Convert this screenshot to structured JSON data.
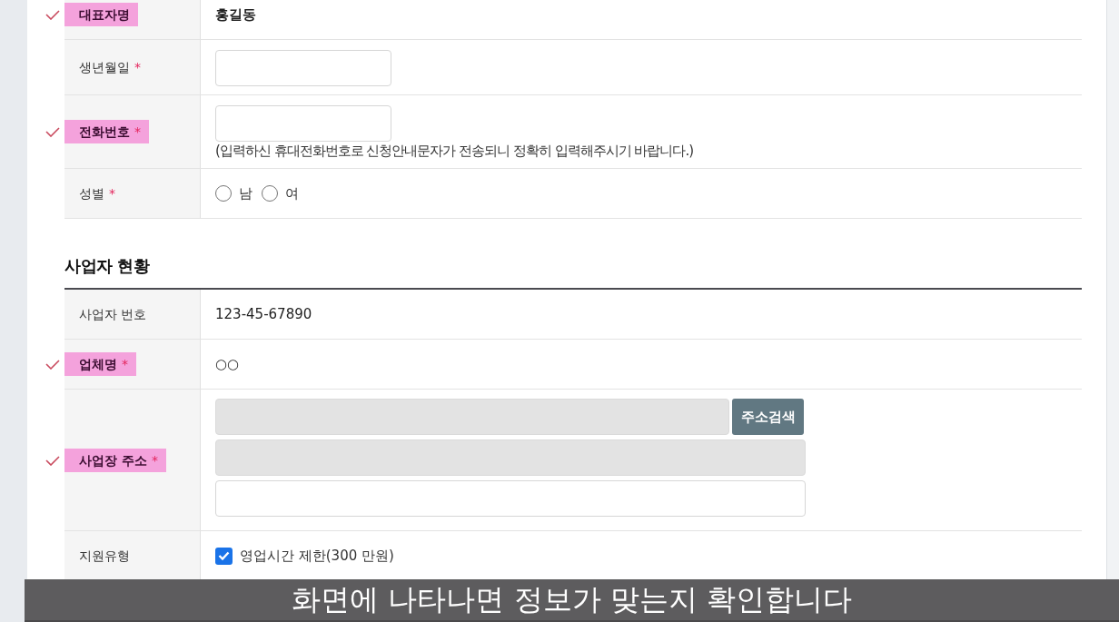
{
  "sections": [
    {
      "rows": [
        {
          "kind": "text",
          "label": "대표자명",
          "highlighted": true,
          "ticked": true,
          "value": "홍길동",
          "bold": true
        },
        {
          "kind": "input",
          "label": "생년월일",
          "required_mark": "*",
          "highlighted": false,
          "ticked": false,
          "fields": [
            {
              "disabled": false
            }
          ]
        },
        {
          "kind": "input",
          "label": "전화번호",
          "required_mark": "*",
          "highlighted": true,
          "ticked": true,
          "fields": [
            {
              "disabled": false
            }
          ],
          "note": "(입력하신 휴대전화번호로 신청안내문자가 전송되니 정확히 입력해주시기 바랍니다.)"
        },
        {
          "kind": "radio",
          "label": "성별",
          "required_mark": "*",
          "highlighted": false,
          "ticked": false,
          "options": [
            {
              "label": "남",
              "selected": false
            },
            {
              "label": "여",
              "selected": false
            }
          ]
        }
      ]
    },
    {
      "title": "사업자 현황",
      "rows": [
        {
          "kind": "text",
          "label": "사업자 번호",
          "highlighted": false,
          "ticked": false,
          "value": "123-45-67890",
          "bold": false
        },
        {
          "kind": "text",
          "label": "업체명",
          "required_mark": "*",
          "highlighted": true,
          "ticked": true,
          "value": "○○",
          "bold": false
        },
        {
          "kind": "address",
          "label": "사업장 주소",
          "required_mark": "*",
          "highlighted": true,
          "ticked": true,
          "fields": [
            {
              "disabled": true
            },
            {
              "disabled": true
            },
            {
              "disabled": false
            }
          ],
          "button": "주소검색"
        },
        {
          "kind": "checkbox",
          "label": "지원유형",
          "highlighted": false,
          "ticked": false,
          "options": [
            {
              "label": "영업시간 제한(300 만원)",
              "checked": true
            }
          ]
        }
      ]
    }
  ],
  "subtitle": "화면에 나타나면 정보가 맞는지 확인합니다"
}
